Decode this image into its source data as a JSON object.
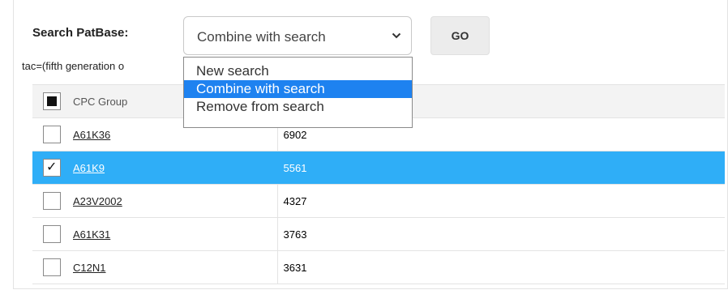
{
  "search": {
    "label": "Search PatBase:",
    "mode_selected": "Combine with search",
    "go_label": "GO",
    "options": [
      "New search",
      "Combine with search",
      "Remove from search"
    ],
    "active_option": "Combine with search"
  },
  "query_text": "tac=(fifth generation o",
  "table": {
    "header": {
      "group": "CPC Group",
      "count": ""
    },
    "rows": [
      {
        "group": "A61K36",
        "count": "6902",
        "checked": false
      },
      {
        "group": "A61K9",
        "count": "5561",
        "checked": true
      },
      {
        "group": "A23V2002",
        "count": "4327",
        "checked": false
      },
      {
        "group": "A61K31",
        "count": "3763",
        "checked": false
      },
      {
        "group": "C12N1",
        "count": "3631",
        "checked": false
      }
    ]
  },
  "colors": {
    "selected_row": "#2faef7",
    "active_option": "#1e82f0"
  }
}
